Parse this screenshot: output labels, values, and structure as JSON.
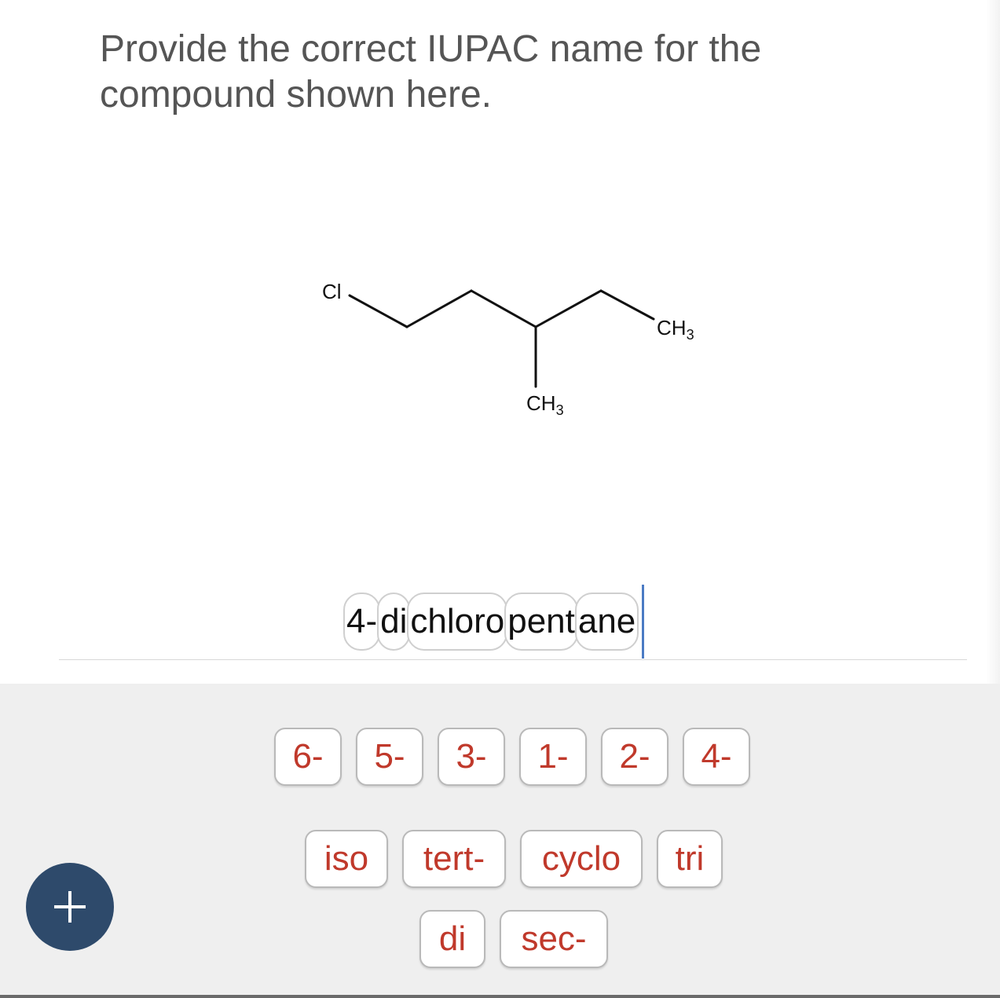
{
  "question": "Provide the correct IUPAC name for the compound shown here.",
  "molecule": {
    "cl_label": "Cl",
    "ch3_label": "CH",
    "ch3_subscript": "3"
  },
  "answer_tiles": [
    "4-",
    "di",
    "chloro",
    "pent",
    "ane"
  ],
  "bank_row_1": [
    "6-",
    "5-",
    "3-",
    "1-",
    "2-",
    "4-"
  ],
  "bank_row_2": [
    "iso",
    "tert-",
    "cyclo",
    "tri"
  ],
  "bank_row_3": [
    "di",
    "sec-"
  ],
  "add_icon": "plus-icon",
  "colors": {
    "chip_text": "#c0392b",
    "cursor": "#4b7bc4",
    "add_button": "#2e4a6b",
    "bank_background": "#efefef"
  }
}
